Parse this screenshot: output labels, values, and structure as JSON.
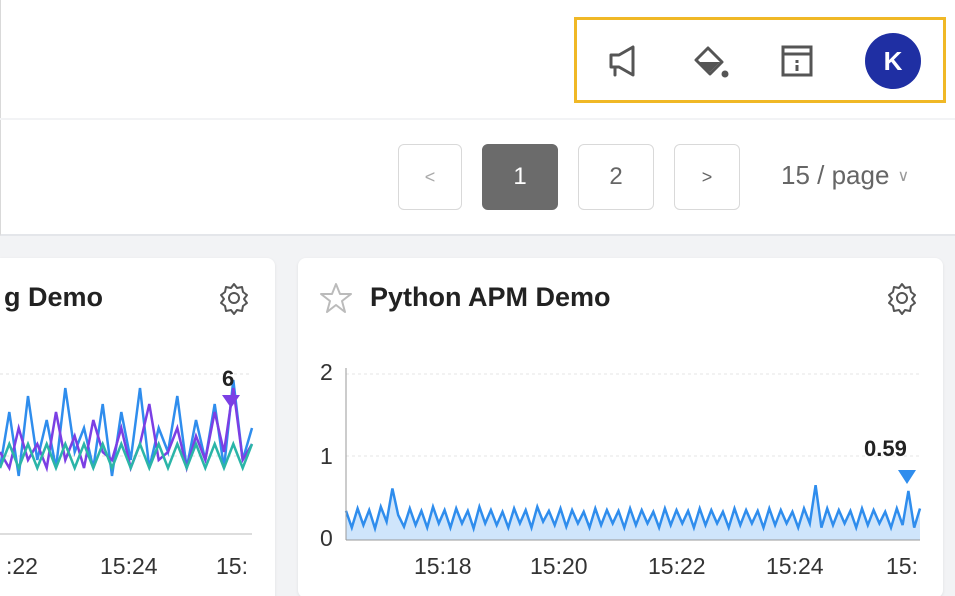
{
  "header": {
    "icons": [
      "megaphone-icon",
      "paint-bucket-icon",
      "info-panel-icon"
    ],
    "avatar_letter": "K",
    "avatar_color": "#1f2fa3",
    "highlight_color": "#f0b826"
  },
  "pagination": {
    "prev": "<",
    "pages": [
      "1",
      "2"
    ],
    "active_page": "1",
    "next": ">",
    "page_size": "15 / page"
  },
  "cards": {
    "left": {
      "title": "g Demo",
      "peak_label": "6",
      "x_ticks": [
        ":22",
        "15:24",
        "15:"
      ],
      "series_colors": [
        "#2f8ded",
        "#7b3fe4",
        "#2bb5a8"
      ]
    },
    "right": {
      "title": "Python APM Demo",
      "starred": false,
      "peak_label": "0.59",
      "y_ticks": [
        "2",
        "1",
        "0"
      ],
      "x_ticks": [
        "15:18",
        "15:20",
        "15:22",
        "15:24",
        "15:"
      ],
      "series_color": "#2f8ded",
      "fill_color": "#cfe5fb"
    }
  },
  "chart_data": [
    {
      "type": "line",
      "title": "",
      "x_ticks": [
        ":22",
        "15:24",
        "15:"
      ],
      "series": [
        {
          "values": [
            0.5,
            1.2,
            0.4,
            1.4,
            0.6,
            1.1,
            0.5,
            1.5,
            0.7,
            1.0,
            0.5,
            1.3,
            0.4,
            1.2,
            0.6,
            1.5,
            0.5,
            1.0,
            0.7,
            1.4,
            0.5,
            1.1,
            0.6,
            1.3,
            0.5,
            1.6,
            0.6,
            1.0
          ]
        },
        {
          "values": [
            0.7,
            0.5,
            1.0,
            0.6,
            0.8,
            0.5,
            1.2,
            0.6,
            0.9,
            0.5,
            1.1,
            0.7,
            0.6,
            1.0,
            0.5,
            0.8,
            1.3,
            0.6,
            0.7,
            1.0,
            0.5,
            0.9,
            0.6,
            1.2,
            0.7,
            1.5,
            0.6,
            0.8
          ]
        },
        {
          "values": [
            0.5,
            0.8,
            0.5,
            0.8,
            0.5,
            0.8,
            0.5,
            0.8,
            0.5,
            0.8,
            0.5,
            0.8,
            0.5,
            0.8,
            0.5,
            0.8,
            0.5,
            0.8,
            0.5,
            0.8,
            0.5,
            0.8,
            0.5,
            0.8,
            0.5,
            0.8,
            0.5,
            0.8
          ]
        }
      ],
      "peak": 6
    },
    {
      "type": "area",
      "title": "Python APM Demo",
      "ylim": [
        0,
        2
      ],
      "y_ticks": [
        0,
        1,
        2
      ],
      "x_ticks": [
        "15:18",
        "15:20",
        "15:22",
        "15:24",
        "15:"
      ],
      "series": [
        {
          "values": [
            0.35,
            0.15,
            0.38,
            0.18,
            0.36,
            0.14,
            0.4,
            0.22,
            0.62,
            0.3,
            0.16,
            0.38,
            0.18,
            0.35,
            0.15,
            0.4,
            0.2,
            0.36,
            0.15,
            0.38,
            0.2,
            0.35,
            0.14,
            0.4,
            0.2,
            0.36,
            0.18,
            0.34,
            0.15,
            0.38,
            0.2,
            0.36,
            0.15,
            0.4,
            0.22,
            0.35,
            0.18,
            0.38,
            0.16,
            0.36,
            0.2,
            0.34,
            0.15,
            0.38,
            0.18,
            0.36,
            0.2,
            0.35,
            0.15,
            0.38,
            0.18,
            0.36,
            0.2,
            0.34,
            0.15,
            0.38,
            0.18,
            0.36,
            0.2,
            0.35,
            0.15,
            0.38,
            0.18,
            0.36,
            0.2,
            0.34,
            0.15,
            0.38,
            0.18,
            0.36,
            0.2,
            0.35,
            0.15,
            0.38,
            0.18,
            0.36,
            0.2,
            0.34,
            0.15,
            0.38,
            0.2,
            0.66,
            0.15,
            0.38,
            0.18,
            0.36,
            0.2,
            0.35,
            0.15,
            0.38,
            0.18,
            0.36,
            0.2,
            0.34,
            0.15,
            0.38,
            0.18,
            0.59,
            0.15,
            0.38
          ]
        }
      ],
      "peak": 0.59
    }
  ]
}
